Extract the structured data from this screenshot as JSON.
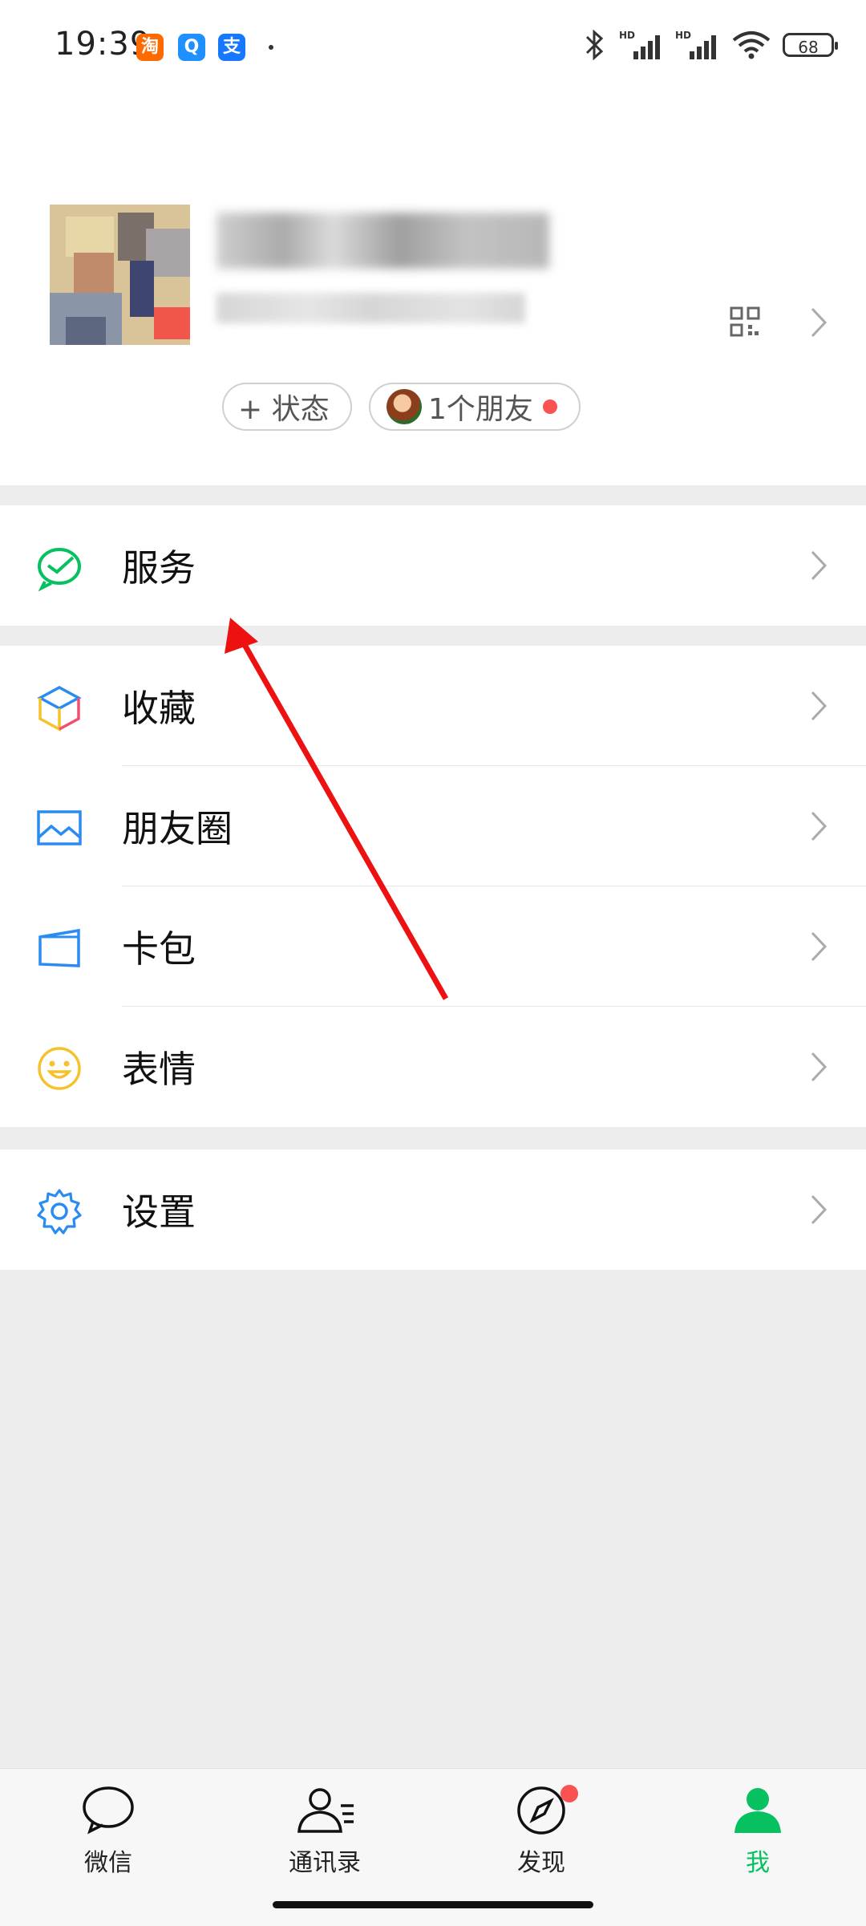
{
  "status_bar": {
    "time": "19:39",
    "app_icons": [
      {
        "name": "taobao-icon",
        "glyph": "淘",
        "color": "#ff6a00"
      },
      {
        "name": "qq-icon",
        "glyph": "Q",
        "color": "#1e90ff"
      },
      {
        "name": "alipay-icon",
        "glyph": "支",
        "color": "#1677ff"
      }
    ],
    "signal_label": "HD",
    "battery": "68"
  },
  "profile": {
    "status_chip_label": "+ 状态",
    "friends_chip_label": "1个朋友"
  },
  "menu": {
    "service": "服务",
    "favorites": "收藏",
    "moments": "朋友圈",
    "cards": "卡包",
    "stickers": "表情",
    "settings": "设置"
  },
  "tabs": [
    {
      "label": "微信",
      "icon": "chat-bubble-icon"
    },
    {
      "label": "通讯录",
      "icon": "contacts-icon"
    },
    {
      "label": "发现",
      "icon": "discover-compass-icon"
    },
    {
      "label": "我",
      "icon": "me-person-icon"
    }
  ],
  "colors": {
    "accent": "#07c160",
    "badge": "#fa5151",
    "annotation_arrow": "#ee1111"
  }
}
